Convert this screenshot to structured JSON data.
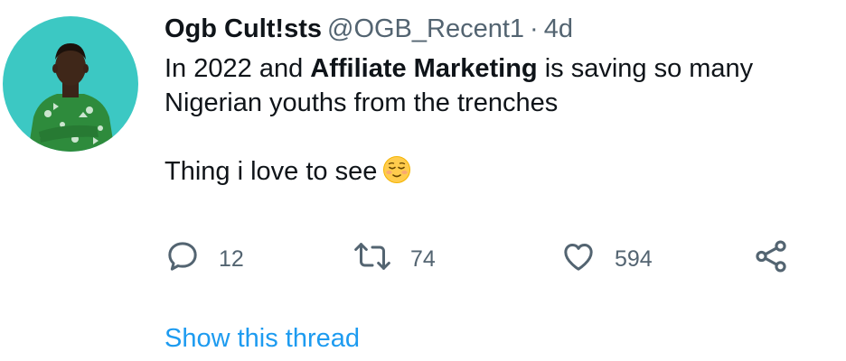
{
  "tweet": {
    "display_name": "Ogb Cult!sts",
    "handle": "@OGB_Recent1",
    "separator": "·",
    "time": "4d",
    "text_line1_a": "In 2022 and ",
    "text_line1_bold": "Affiliate Marketing",
    "text_line1_b": " is saving so many",
    "text_line2": "Nigerian youths from the trenches",
    "text_line3": "Thing i love to see",
    "emoji": "relieved-face-emoji"
  },
  "actions": {
    "reply": {
      "icon": "reply-icon",
      "count": "12"
    },
    "retweet": {
      "icon": "retweet-icon",
      "count": "74"
    },
    "like": {
      "icon": "heart-icon",
      "count": "594"
    },
    "share": {
      "icon": "share-icon"
    }
  },
  "thread_link": "Show this thread",
  "colors": {
    "text": "#0f1419",
    "muted": "#536471",
    "link": "#1d9bf0",
    "avatar_bg": "#38c9c4",
    "shirt": "#2e8b3c"
  }
}
